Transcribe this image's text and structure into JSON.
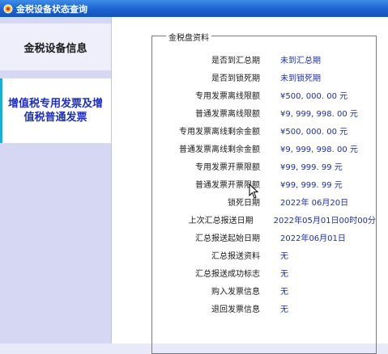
{
  "window": {
    "title": "金税设备状态查询",
    "icon": "app-icon"
  },
  "sidebar": {
    "items": [
      {
        "label": "金税设备信息",
        "selected": false
      },
      {
        "label": "增值税专用发票及增值税普通发票",
        "selected": true
      }
    ]
  },
  "panel": {
    "legend": "金税盘资料",
    "rows": [
      {
        "label": "是否到汇总期",
        "value": "未到汇总期"
      },
      {
        "label": "是否到锁死期",
        "value": "未到锁死期"
      },
      {
        "label": "专用发票离线限额",
        "value": "¥500, 000. 00 元"
      },
      {
        "label": "普通发票离线限额",
        "value": "¥9, 999, 998. 00 元"
      },
      {
        "label": "专用发票离线剩余金额",
        "value": "¥500, 000. 00 元"
      },
      {
        "label": "普通发票离线剩余金额",
        "value": "¥9, 999, 998. 00 元"
      },
      {
        "label": "专用发票开票限额",
        "value": "¥99, 999. 99 元"
      },
      {
        "label": "普通发票开票限额",
        "value": "¥99, 999. 99 元"
      },
      {
        "label": "锁死日期",
        "value": "2022年 06月20日"
      },
      {
        "label": "上次汇总报送日期",
        "value": "2022年05月01日00时00分"
      },
      {
        "label": "汇总报送起始日期",
        "value": "2022年06月01日"
      },
      {
        "label": "汇总报送资料",
        "value": "无"
      },
      {
        "label": "汇总报送成功标志",
        "value": "无"
      },
      {
        "label": "购入发票信息",
        "value": "无"
      },
      {
        "label": "退回发票信息",
        "value": "无"
      }
    ]
  },
  "colors": {
    "titlebar": "#1b63d0",
    "sidebar": "#d6d8f3",
    "selected_text": "#1e2fbf",
    "selected_accent": "#11b2d6",
    "value_text": "#1e2fa6"
  }
}
